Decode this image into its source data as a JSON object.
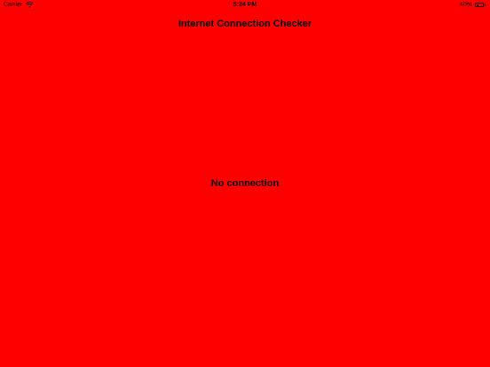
{
  "status_bar": {
    "carrier": "Carrier",
    "time": "5:34 PM",
    "battery_percent_label": "40%",
    "battery_level": 0.4,
    "wifi_icon": "wifi-icon",
    "battery_icon": "battery-icon"
  },
  "nav": {
    "title": "Internet Connection Checker"
  },
  "main": {
    "message": "No connection",
    "background_color": "#ff0000"
  }
}
